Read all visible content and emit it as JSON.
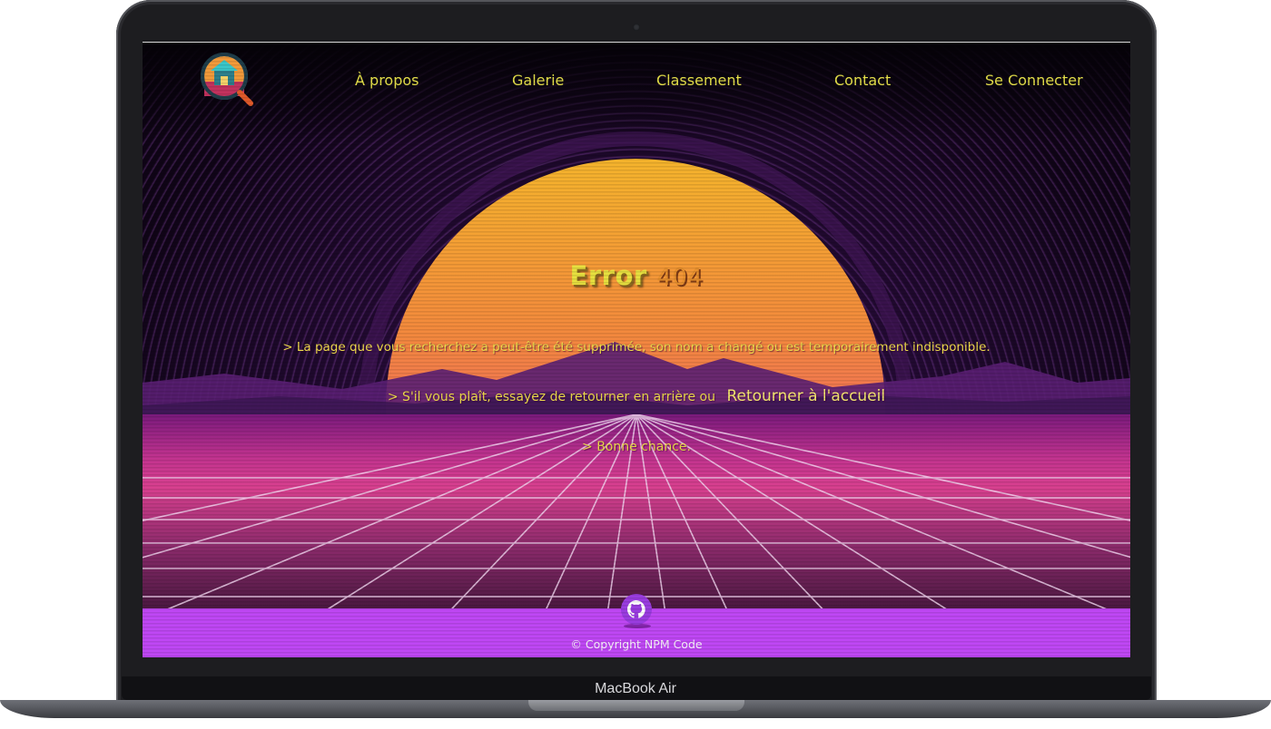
{
  "device": {
    "label": "MacBook Air"
  },
  "nav": {
    "about": "À propos",
    "gallery": "Galerie",
    "ranking": "Classement",
    "contact": "Contact",
    "login": "Se Connecter"
  },
  "error": {
    "title": "Error",
    "code": "404",
    "line1": "> La page que vous recherchez a peut-être été supprimée, son nom a changé ou est temporairement indisponible.",
    "line2": "> S'il vous plaît, essayez de retourner en arrière ou",
    "home_link": "Retourner à l'accueil",
    "line3": "> Bonne chance."
  },
  "footer": {
    "copyright": "© Copyright NPM Code",
    "icon": "github-icon"
  },
  "colors": {
    "accent_text": "#e7e03f",
    "code": "#e7902d",
    "footer_bg": "#bf47f4"
  }
}
